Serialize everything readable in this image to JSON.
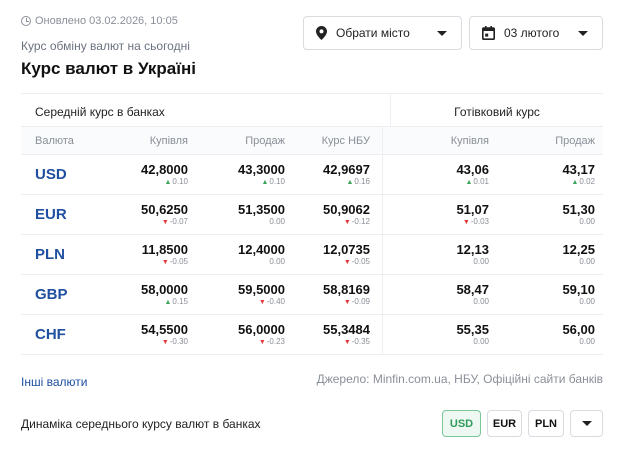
{
  "header": {
    "updated": "Оновлено 03.02.2026, 10:05",
    "subtitle": "Курс обміну валют на сьогодні",
    "title": "Курс валют в Україні"
  },
  "controls": {
    "city_label": "Обрати місто",
    "date_label": "03 лютого"
  },
  "table": {
    "group_avg": "Середній курс в банках",
    "group_cash": "Готівковий курс",
    "columns": {
      "currency": "Валюта",
      "buy": "Купівля",
      "sell": "Продаж",
      "nbu": "Курс НБУ",
      "cash_buy": "Купівля",
      "cash_sell": "Продаж"
    },
    "rows": [
      {
        "code": "USD",
        "buy": "42,8000",
        "buy_chg": "0.10",
        "buy_dir": "up",
        "sell": "43,3000",
        "sell_chg": "0.10",
        "sell_dir": "up",
        "nbu": "42,9697",
        "nbu_chg": "0.16",
        "nbu_dir": "up",
        "cbuy": "43,06",
        "cbuy_chg": "0.01",
        "cbuy_dir": "up",
        "csell": "43,17",
        "csell_chg": "0.02",
        "csell_dir": "up"
      },
      {
        "code": "EUR",
        "buy": "50,6250",
        "buy_chg": "-0.07",
        "buy_dir": "down",
        "sell": "51,3500",
        "sell_chg": "0.00",
        "sell_dir": "none",
        "nbu": "50,9062",
        "nbu_chg": "-0.12",
        "nbu_dir": "down",
        "cbuy": "51,07",
        "cbuy_chg": "-0.03",
        "cbuy_dir": "down",
        "csell": "51,30",
        "csell_chg": "0.00",
        "csell_dir": "none"
      },
      {
        "code": "PLN",
        "buy": "11,8500",
        "buy_chg": "-0.05",
        "buy_dir": "down",
        "sell": "12,4000",
        "sell_chg": "0.00",
        "sell_dir": "none",
        "nbu": "12,0735",
        "nbu_chg": "-0.05",
        "nbu_dir": "down",
        "cbuy": "12,13",
        "cbuy_chg": "0.00",
        "cbuy_dir": "none",
        "csell": "12,25",
        "csell_chg": "0.00",
        "csell_dir": "none"
      },
      {
        "code": "GBP",
        "buy": "58,0000",
        "buy_chg": "0.15",
        "buy_dir": "up",
        "sell": "59,5000",
        "sell_chg": "-0.40",
        "sell_dir": "down",
        "nbu": "58,8169",
        "nbu_chg": "-0.09",
        "nbu_dir": "down",
        "cbuy": "58,47",
        "cbuy_chg": "0.00",
        "cbuy_dir": "none",
        "csell": "59,10",
        "csell_chg": "0.00",
        "csell_dir": "none"
      },
      {
        "code": "CHF",
        "buy": "54,5500",
        "buy_chg": "-0.30",
        "buy_dir": "down",
        "sell": "56,0000",
        "sell_chg": "-0.23",
        "sell_dir": "down",
        "nbu": "55,3484",
        "nbu_chg": "-0.35",
        "nbu_dir": "down",
        "cbuy": "55,35",
        "cbuy_chg": "0.00",
        "cbuy_dir": "none",
        "csell": "56,00",
        "csell_chg": "0.00",
        "csell_dir": "none"
      }
    ]
  },
  "footer": {
    "other_link": "Інші валюти",
    "source": "Джерело: Minfin.com.ua, НБУ, Офіційні сайти банків"
  },
  "dynamics": {
    "label": "Динаміка середнього курсу валют в банках",
    "options": [
      "USD",
      "EUR",
      "PLN"
    ],
    "active": "USD"
  },
  "colors": {
    "up": "#3ba55c",
    "down": "#e03a3a",
    "currency_link": "#1f4fa0",
    "active_pill": "#2e9a5b"
  },
  "icons": {
    "updated": "clock-icon",
    "city": "location-pin-icon",
    "date": "calendar-icon",
    "dropdown": "chevron-down-icon"
  }
}
